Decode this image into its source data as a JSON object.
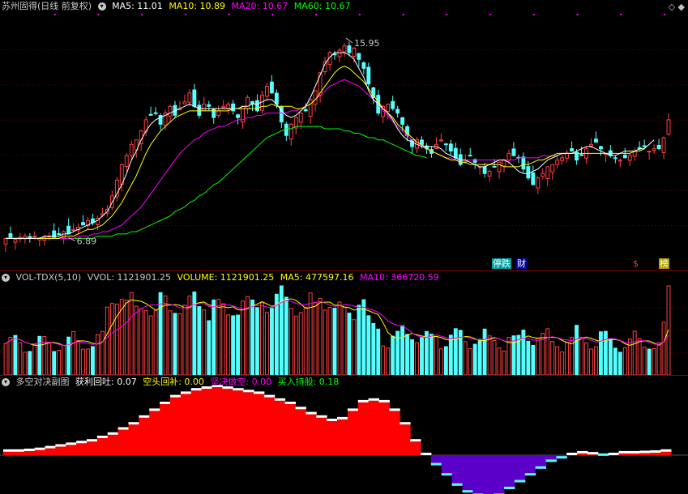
{
  "main": {
    "title": "苏州固得(日线 前复权)",
    "ma5_label": "MA5: 11.01",
    "ma10_label": "MA10: 10.89",
    "ma20_label": "MA20: 10.67",
    "ma60_label": "MA60: 10.67",
    "high_label": "15.95",
    "low_label": "6.89",
    "badge_tingdie": "停跌",
    "badge_cai": "财",
    "badge_s": "$",
    "badge_bang": "榜",
    "corner_icon": "diamond-icon",
    "colors": {
      "ma5": "#ffffff",
      "ma10": "#ffff00",
      "ma20": "#ff00ff",
      "ma60": "#00ff00",
      "up": "#ff4040",
      "down": "#54ffff"
    }
  },
  "volume": {
    "title": "VOL-TDX(5,10)",
    "vvol_label": "VVOL: 1121901.25",
    "volume_label": "VOLUME: 1121901.25",
    "ma5_label": "MA5: 477597.16",
    "ma10_label": "MA10: 366720.59"
  },
  "indicator": {
    "title": "多空对决副图",
    "profit_label": "获利回吐: 0.07",
    "short_label": "空头回补: 0.00",
    "firm_short_label": "坚决做空: 0.00",
    "buy_hold_label": "买入持股: 0.18"
  },
  "chart_data": {
    "type": "candlestick",
    "price_range": [
      6.0,
      17.0
    ],
    "high": 15.95,
    "low": 6.89,
    "close": [
      7.0,
      7.05,
      6.95,
      7.05,
      7.1,
      7.0,
      7.1,
      7.0,
      7.05,
      7.1,
      7.05,
      7.2,
      7.3,
      7.2,
      7.4,
      7.5,
      7.6,
      7.8,
      7.7,
      7.9,
      8.1,
      8.3,
      8.9,
      9.6,
      10.3,
      10.7,
      11.2,
      11.4,
      11.8,
      12.3,
      12.5,
      12.6,
      12.1,
      12.6,
      12.9,
      12.5,
      12.8,
      13.1,
      13.5,
      12.9,
      12.5,
      13.0,
      12.9,
      12.4,
      12.7,
      12.9,
      13.0,
      12.7,
      12.4,
      12.9,
      13.3,
      13.0,
      12.7,
      13.4,
      13.8,
      13.5,
      13.0,
      12.2,
      11.6,
      12.1,
      12.4,
      12.6,
      12.7,
      13.2,
      13.6,
      14.4,
      14.9,
      15.3,
      15.2,
      15.4,
      15.6,
      15.3,
      15.5,
      15.0,
      14.6,
      13.9,
      13.3,
      12.6,
      12.9,
      13.0,
      12.8,
      12.6,
      12.1,
      11.6,
      11.1,
      11.4,
      11.2,
      11.0,
      10.8,
      11.2,
      11.4,
      11.2,
      10.9,
      10.6,
      10.3,
      10.5,
      10.7,
      10.4,
      10.2,
      9.9,
      10.0,
      10.2,
      10.4,
      10.5,
      10.8,
      10.7,
      10.6,
      10.1,
      9.7,
      9.4,
      9.7,
      9.9,
      10.2,
      10.3,
      10.5,
      10.6,
      10.8,
      10.9,
      10.5,
      10.7,
      11.0,
      11.2,
      11.3,
      11.0,
      10.8,
      10.7,
      10.6,
      10.5,
      10.6,
      10.7,
      10.9,
      11.0,
      11.1,
      10.9,
      11.0,
      11.01,
      11.5,
      12.3
    ],
    "ma5": [
      7.0,
      7.0,
      7.0,
      7.0,
      7.0,
      7.0,
      7.0,
      7.0,
      7.1,
      7.1,
      7.1,
      7.1,
      7.2,
      7.2,
      7.3,
      7.4,
      7.5,
      7.6,
      7.7,
      7.8,
      8.0,
      8.2,
      8.6,
      9.0,
      9.4,
      9.9,
      10.5,
      10.9,
      11.4,
      11.8,
      12.1,
      12.3,
      12.4,
      12.5,
      12.6,
      12.7,
      12.8,
      12.9,
      13.0,
      12.9,
      12.8,
      12.8,
      12.8,
      12.8,
      12.8,
      12.8,
      12.8,
      12.8,
      12.8,
      12.9,
      12.9,
      13.0,
      13.0,
      13.1,
      13.2,
      13.2,
      13.0,
      12.7,
      12.5,
      12.4,
      12.5,
      12.7,
      12.9,
      13.3,
      13.8,
      14.3,
      14.8,
      15.1,
      15.3,
      15.3,
      15.3,
      15.2,
      15.0,
      14.6,
      14.2,
      13.6,
      13.2,
      13.0,
      12.8,
      12.6,
      12.3,
      11.9,
      11.6,
      11.4,
      11.3,
      11.2,
      11.1,
      11.1,
      11.1,
      11.1,
      11.0,
      10.8,
      10.7,
      10.6,
      10.5,
      10.5,
      10.4,
      10.3,
      10.2,
      10.2,
      10.3,
      10.4,
      10.5,
      10.5,
      10.4,
      10.2,
      10.0,
      9.9,
      9.9,
      10.0,
      10.1,
      10.3,
      10.5,
      10.6,
      10.7,
      10.8,
      10.8,
      10.8,
      10.9,
      11.0,
      11.1,
      11.1,
      11.0,
      10.9,
      10.8,
      10.7,
      10.7,
      10.8,
      10.9,
      10.9,
      10.9,
      11.0,
      11.01,
      11.2,
      11.4
    ],
    "ma10": [
      7.0,
      7.0,
      7.0,
      7.0,
      7.0,
      7.0,
      7.0,
      7.0,
      7.0,
      7.0,
      7.0,
      7.0,
      7.1,
      7.1,
      7.1,
      7.2,
      7.3,
      7.4,
      7.4,
      7.5,
      7.6,
      7.8,
      8.0,
      8.3,
      8.6,
      9.0,
      9.4,
      9.8,
      10.3,
      10.8,
      11.2,
      11.5,
      11.8,
      12.0,
      12.2,
      12.4,
      12.5,
      12.6,
      12.7,
      12.7,
      12.7,
      12.7,
      12.7,
      12.7,
      12.7,
      12.7,
      12.7,
      12.8,
      12.8,
      12.8,
      12.8,
      12.8,
      12.8,
      12.9,
      12.9,
      13.0,
      12.9,
      12.9,
      12.9,
      12.9,
      12.8,
      12.8,
      12.9,
      13.0,
      13.2,
      13.5,
      13.8,
      14.1,
      14.4,
      14.6,
      14.7,
      14.6,
      14.4,
      14.2,
      14.0,
      13.7,
      13.4,
      13.1,
      12.8,
      12.6,
      12.4,
      12.1,
      11.9,
      11.7,
      11.5,
      11.3,
      11.2,
      11.0,
      10.9,
      10.8,
      10.7,
      10.6,
      10.5,
      10.5,
      10.4,
      10.4,
      10.3,
      10.3,
      10.3,
      10.3,
      10.3,
      10.3,
      10.3,
      10.2,
      10.2,
      10.2,
      10.2,
      10.3,
      10.3,
      10.4,
      10.5,
      10.5,
      10.6,
      10.7,
      10.8,
      10.8,
      10.8,
      10.8,
      10.8,
      10.8,
      10.8,
      10.8,
      10.8,
      10.8,
      10.8,
      10.8,
      10.8,
      10.8,
      10.8,
      10.8,
      10.89,
      10.9,
      11.0
    ],
    "ma20": [
      7.0,
      7.0,
      7.0,
      7.0,
      7.0,
      7.0,
      7.0,
      7.0,
      7.0,
      7.0,
      7.0,
      7.0,
      7.0,
      7.0,
      7.0,
      7.1,
      7.1,
      7.1,
      7.2,
      7.2,
      7.3,
      7.3,
      7.4,
      7.5,
      7.6,
      7.8,
      8.0,
      8.2,
      8.4,
      8.7,
      9.0,
      9.3,
      9.6,
      9.9,
      10.2,
      10.5,
      10.8,
      11.0,
      11.2,
      11.4,
      11.5,
      11.7,
      11.8,
      11.9,
      12.0,
      12.0,
      12.1,
      12.2,
      12.3,
      12.3,
      12.4,
      12.4,
      12.5,
      12.5,
      12.6,
      12.6,
      12.6,
      12.6,
      12.6,
      12.7,
      12.7,
      12.8,
      12.9,
      13.0,
      13.2,
      13.4,
      13.6,
      13.8,
      13.9,
      14.0,
      14.1,
      14.0,
      13.9,
      13.8,
      13.6,
      13.4,
      13.2,
      13.0,
      12.7,
      12.5,
      12.2,
      12.0,
      11.8,
      11.6,
      11.4,
      11.3,
      11.1,
      11.0,
      10.9,
      10.8,
      10.7,
      10.6,
      10.6,
      10.5,
      10.5,
      10.5,
      10.5,
      10.5,
      10.5,
      10.5,
      10.5,
      10.5,
      10.5,
      10.5,
      10.5,
      10.5,
      10.6,
      10.6,
      10.6,
      10.6,
      10.6,
      10.7,
      10.67,
      10.7,
      10.7
    ],
    "ma60": [
      7.0,
      7.0,
      7.0,
      7.0,
      7.0,
      7.0,
      7.0,
      7.0,
      7.0,
      7.0,
      7.0,
      7.0,
      7.0,
      7.0,
      7.0,
      7.0,
      7.0,
      7.0,
      7.0,
      7.1,
      7.1,
      7.1,
      7.1,
      7.2,
      7.2,
      7.2,
      7.3,
      7.3,
      7.4,
      7.5,
      7.6,
      7.7,
      7.8,
      7.9,
      8.0,
      8.2,
      8.3,
      8.4,
      8.6,
      8.7,
      8.9,
      9.0,
      9.2,
      9.4,
      9.5,
      9.7,
      9.9,
      10.1,
      10.3,
      10.5,
      10.7,
      10.9,
      11.1,
      11.3,
      11.5,
      11.6,
      11.7,
      11.8,
      11.9,
      11.9,
      12.0,
      12.0,
      12.0,
      12.0,
      12.0,
      12.0,
      11.9,
      11.9,
      11.9,
      11.9,
      11.8,
      11.8,
      11.7,
      11.7,
      11.6,
      11.5,
      11.5,
      11.4,
      11.4,
      11.3,
      11.2,
      11.1,
      11.0,
      10.9,
      10.8,
      10.7,
      10.67,
      10.6
    ],
    "volume_ma5": 477597.16,
    "volume_ma10": 366720.59,
    "volume": 1121901.25,
    "indicator_values": [
      0.1,
      0.1,
      0.12,
      0.15,
      0.2,
      0.25,
      0.3,
      0.35,
      0.4,
      0.5,
      0.6,
      0.75,
      0.9,
      1.1,
      1.3,
      1.5,
      1.7,
      1.8,
      1.9,
      1.95,
      2.0,
      1.95,
      1.9,
      1.85,
      1.8,
      1.7,
      1.6,
      1.5,
      1.35,
      1.2,
      1.1,
      1.0,
      1.05,
      1.3,
      1.55,
      1.6,
      1.55,
      1.3,
      0.9,
      0.4,
      0.0,
      -0.3,
      -0.6,
      -0.9,
      -1.1,
      -1.2,
      -1.25,
      -1.2,
      -1.0,
      -0.8,
      -0.6,
      -0.4,
      -0.2,
      -0.1,
      0.0,
      0.05,
      0.02,
      -0.02,
      0.0,
      0.05,
      0.05,
      0.06,
      0.07,
      0.1,
      0.25
    ],
    "profit_taking": 0.07,
    "short_covering": 0.0,
    "firm_short": 0.0,
    "buy_hold": 0.18
  }
}
